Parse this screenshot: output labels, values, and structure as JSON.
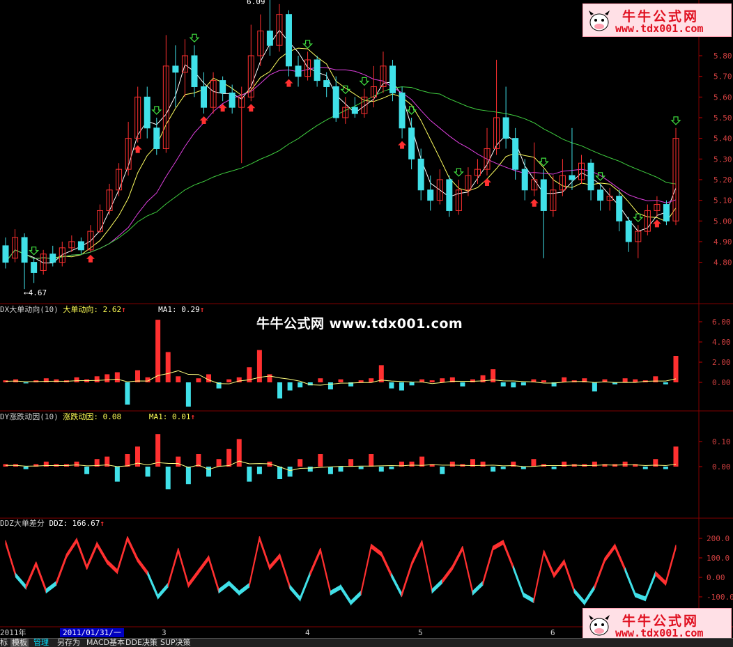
{
  "watermark_center": "牛牛公式网 www.tdx001.com",
  "logo": {
    "line1": "牛牛公式网",
    "line2": "www.tdx001.com",
    "icon": "cow-icon"
  },
  "main_panel": {
    "high_label": "6.09",
    "low_label": "←4.67",
    "price_ticks": [
      "5.80",
      "5.70",
      "5.60",
      "5.50",
      "5.40",
      "5.30",
      "5.20",
      "5.10",
      "5.00",
      "4.90",
      "4.80"
    ]
  },
  "panel1": {
    "name": "DX大单动向(10)",
    "value_label": "大单动向: 2.62",
    "ma_label": "MA1: 0.29",
    "ticks": [
      "6.00",
      "4.00",
      "2.00",
      "0.00"
    ]
  },
  "panel2": {
    "name": "DY涨跌动因(10)",
    "value_label": "涨跌动因: 0.08",
    "ma_label": "MA1: 0.01",
    "ticks": [
      "0.10",
      "0.00"
    ]
  },
  "panel3": {
    "name": "DDZ大单差分",
    "value_label": "DDZ: 166.67",
    "ticks": [
      "200.0",
      "100.0",
      "0.00",
      "-100.0"
    ]
  },
  "time_axis": {
    "year_label": "2011年",
    "cursor_date": "2011/01/31/一",
    "month_labels": [
      "3",
      "4",
      "5",
      "6"
    ]
  },
  "bottom_tabs": [
    "标",
    "模板",
    "管理",
    "另存为",
    "MACD基本",
    "DDE决策",
    "SUP决策"
  ],
  "colors": {
    "up": "#ff3030",
    "down": "#40e0e8",
    "ma5": "#ffffff",
    "ma10": "#ffff60",
    "ma20": "#e040e0",
    "ma60": "#40d040",
    "grid": "#800000"
  },
  "chart_data": {
    "type": "candlestick",
    "y_range": [
      4.67,
      6.09
    ],
    "candles": [
      {
        "o": 4.88,
        "c": 4.8,
        "h": 4.92,
        "l": 4.77
      },
      {
        "o": 4.82,
        "c": 4.92,
        "h": 4.96,
        "l": 4.8
      },
      {
        "o": 4.92,
        "c": 4.8,
        "h": 4.94,
        "l": 4.67
      },
      {
        "o": 4.8,
        "c": 4.75,
        "h": 4.82,
        "l": 4.7
      },
      {
        "o": 4.76,
        "c": 4.84,
        "h": 4.86,
        "l": 4.74
      },
      {
        "o": 4.84,
        "c": 4.8,
        "h": 4.88,
        "l": 4.78
      },
      {
        "o": 4.8,
        "c": 4.87,
        "h": 4.9,
        "l": 4.78
      },
      {
        "o": 4.87,
        "c": 4.9,
        "h": 4.93,
        "l": 4.85
      },
      {
        "o": 4.9,
        "c": 4.86,
        "h": 4.92,
        "l": 4.84
      },
      {
        "o": 4.86,
        "c": 4.95,
        "h": 4.98,
        "l": 4.85
      },
      {
        "o": 4.95,
        "c": 5.05,
        "h": 5.08,
        "l": 4.94
      },
      {
        "o": 5.05,
        "c": 5.15,
        "h": 5.18,
        "l": 5.03
      },
      {
        "o": 5.15,
        "c": 5.25,
        "h": 5.28,
        "l": 5.12
      },
      {
        "o": 5.25,
        "c": 5.4,
        "h": 5.48,
        "l": 5.22
      },
      {
        "o": 5.4,
        "c": 5.6,
        "h": 5.65,
        "l": 5.38
      },
      {
        "o": 5.6,
        "c": 5.45,
        "h": 5.65,
        "l": 5.4
      },
      {
        "o": 5.45,
        "c": 5.35,
        "h": 5.5,
        "l": 5.32
      },
      {
        "o": 5.35,
        "c": 5.75,
        "h": 5.9,
        "l": 5.33
      },
      {
        "o": 5.75,
        "c": 5.72,
        "h": 5.85,
        "l": 5.55
      },
      {
        "o": 5.72,
        "c": 5.8,
        "h": 5.88,
        "l": 5.6
      },
      {
        "o": 5.8,
        "c": 5.65,
        "h": 5.85,
        "l": 5.6
      },
      {
        "o": 5.65,
        "c": 5.55,
        "h": 5.72,
        "l": 5.52
      },
      {
        "o": 5.55,
        "c": 5.68,
        "h": 5.72,
        "l": 5.52
      },
      {
        "o": 5.68,
        "c": 5.62,
        "h": 5.7,
        "l": 5.58
      },
      {
        "o": 5.62,
        "c": 5.55,
        "h": 5.66,
        "l": 5.52
      },
      {
        "o": 5.55,
        "c": 5.6,
        "h": 5.65,
        "l": 5.28
      },
      {
        "o": 5.6,
        "c": 5.8,
        "h": 5.95,
        "l": 5.58
      },
      {
        "o": 5.8,
        "c": 5.92,
        "h": 6.0,
        "l": 5.75
      },
      {
        "o": 5.92,
        "c": 5.85,
        "h": 6.09,
        "l": 5.8
      },
      {
        "o": 5.85,
        "c": 6.0,
        "h": 6.05,
        "l": 5.82
      },
      {
        "o": 6.0,
        "c": 5.75,
        "h": 6.02,
        "l": 5.7
      },
      {
        "o": 5.75,
        "c": 5.7,
        "h": 5.8,
        "l": 5.65
      },
      {
        "o": 5.7,
        "c": 5.78,
        "h": 5.82,
        "l": 5.68
      },
      {
        "o": 5.78,
        "c": 5.68,
        "h": 5.8,
        "l": 5.65
      },
      {
        "o": 5.68,
        "c": 5.65,
        "h": 5.72,
        "l": 5.6
      },
      {
        "o": 5.65,
        "c": 5.5,
        "h": 5.7,
        "l": 5.48
      },
      {
        "o": 5.5,
        "c": 5.55,
        "h": 5.6,
        "l": 5.47
      },
      {
        "o": 5.55,
        "c": 5.52,
        "h": 5.6,
        "l": 5.5
      },
      {
        "o": 5.52,
        "c": 5.6,
        "h": 5.64,
        "l": 5.5
      },
      {
        "o": 5.6,
        "c": 5.65,
        "h": 5.75,
        "l": 5.55
      },
      {
        "o": 5.65,
        "c": 5.75,
        "h": 5.82,
        "l": 5.62
      },
      {
        "o": 5.75,
        "c": 5.62,
        "h": 5.78,
        "l": 5.58
      },
      {
        "o": 5.62,
        "c": 5.45,
        "h": 5.65,
        "l": 5.4
      },
      {
        "o": 5.45,
        "c": 5.3,
        "h": 5.5,
        "l": 5.25
      },
      {
        "o": 5.3,
        "c": 5.15,
        "h": 5.35,
        "l": 5.1
      },
      {
        "o": 5.15,
        "c": 5.1,
        "h": 5.22,
        "l": 5.05
      },
      {
        "o": 5.1,
        "c": 5.2,
        "h": 5.25,
        "l": 5.08
      },
      {
        "o": 5.2,
        "c": 5.05,
        "h": 5.22,
        "l": 5.02
      },
      {
        "o": 5.05,
        "c": 5.15,
        "h": 5.2,
        "l": 5.03
      },
      {
        "o": 5.15,
        "c": 5.22,
        "h": 5.26,
        "l": 5.12
      },
      {
        "o": 5.22,
        "c": 5.25,
        "h": 5.3,
        "l": 5.18
      },
      {
        "o": 5.25,
        "c": 5.35,
        "h": 5.45,
        "l": 5.22
      },
      {
        "o": 5.35,
        "c": 5.5,
        "h": 5.78,
        "l": 5.32
      },
      {
        "o": 5.5,
        "c": 5.4,
        "h": 5.65,
        "l": 5.35
      },
      {
        "o": 5.4,
        "c": 5.25,
        "h": 5.45,
        "l": 5.2
      },
      {
        "o": 5.25,
        "c": 5.15,
        "h": 5.3,
        "l": 5.1
      },
      {
        "o": 5.15,
        "c": 5.2,
        "h": 5.38,
        "l": 5.12
      },
      {
        "o": 5.2,
        "c": 5.05,
        "h": 5.25,
        "l": 4.82
      },
      {
        "o": 5.05,
        "c": 5.15,
        "h": 5.22,
        "l": 5.02
      },
      {
        "o": 5.15,
        "c": 5.22,
        "h": 5.3,
        "l": 5.12
      },
      {
        "o": 5.22,
        "c": 5.2,
        "h": 5.45,
        "l": 5.15
      },
      {
        "o": 5.2,
        "c": 5.28,
        "h": 5.32,
        "l": 5.18
      },
      {
        "o": 5.28,
        "c": 5.15,
        "h": 5.3,
        "l": 5.1
      },
      {
        "o": 5.15,
        "c": 5.1,
        "h": 5.18,
        "l": 5.05
      },
      {
        "o": 5.1,
        "c": 5.12,
        "h": 5.16,
        "l": 5.05
      },
      {
        "o": 5.12,
        "c": 5.0,
        "h": 5.15,
        "l": 4.95
      },
      {
        "o": 5.0,
        "c": 4.9,
        "h": 5.02,
        "l": 4.85
      },
      {
        "o": 4.9,
        "c": 4.95,
        "h": 4.98,
        "l": 4.82
      },
      {
        "o": 4.95,
        "c": 5.05,
        "h": 5.08,
        "l": 4.93
      },
      {
        "o": 5.05,
        "c": 5.08,
        "h": 5.12,
        "l": 5.02
      },
      {
        "o": 5.08,
        "c": 5.0,
        "h": 5.1,
        "l": 4.98
      },
      {
        "o": 5.0,
        "c": 5.4,
        "h": 5.45,
        "l": 4.98
      }
    ],
    "panel1_values": [
      0.2,
      0.3,
      -0.1,
      0.2,
      0.4,
      0.3,
      0.2,
      0.5,
      0.3,
      0.6,
      0.8,
      1.0,
      -2.2,
      1.2,
      0.5,
      6.2,
      3.0,
      0.6,
      -2.4,
      0.4,
      0.8,
      -0.6,
      0.3,
      0.5,
      1.5,
      3.2,
      0.8,
      -1.6,
      -0.8,
      -0.5,
      -0.3,
      0.4,
      -0.7,
      0.3,
      -0.4,
      0.2,
      0.4,
      1.7,
      -0.6,
      -0.8,
      -0.3,
      0.3,
      0.2,
      0.4,
      0.5,
      -0.4,
      0.3,
      0.7,
      1.3,
      -0.4,
      -0.5,
      -0.3,
      0.3,
      0.2,
      -0.4,
      0.5,
      0.2,
      0.4,
      -0.9,
      0.3,
      -0.2,
      0.4,
      0.3,
      0.2,
      0.6,
      -0.2,
      2.62
    ],
    "panel2_values": [
      0.01,
      0.01,
      -0.01,
      0.01,
      0.02,
      0.01,
      0.01,
      0.02,
      -0.03,
      0.03,
      0.04,
      -0.06,
      0.05,
      0.08,
      -0.04,
      0.13,
      -0.09,
      0.04,
      -0.07,
      0.05,
      -0.04,
      0.03,
      0.07,
      0.11,
      -0.06,
      -0.03,
      0.02,
      -0.05,
      -0.04,
      0.03,
      -0.02,
      0.05,
      -0.03,
      -0.02,
      0.03,
      -0.01,
      0.05,
      -0.02,
      -0.01,
      0.02,
      0.02,
      0.04,
      0.01,
      -0.03,
      0.02,
      0.01,
      0.03,
      0.02,
      -0.02,
      -0.01,
      0.02,
      -0.01,
      0.03,
      0.01,
      -0.01,
      0.02,
      0.01,
      0.01,
      0.02,
      0.01,
      0.01,
      0.02,
      0.01,
      -0.01,
      0.03,
      -0.01,
      0.08
    ],
    "panel3_values": [
      190,
      20,
      -40,
      80,
      -60,
      -20,
      120,
      200,
      60,
      180,
      90,
      40,
      210,
      100,
      30,
      -90,
      -30,
      150,
      -30,
      40,
      110,
      -60,
      -20,
      -70,
      -30,
      210,
      60,
      120,
      -40,
      -100,
      30,
      150,
      -70,
      -40,
      -120,
      -70,
      170,
      130,
      20,
      -80,
      80,
      190,
      -60,
      -10,
      60,
      160,
      -70,
      -20,
      160,
      190,
      60,
      -80,
      -110,
      140,
      20,
      90,
      -60,
      -120,
      -40,
      100,
      170,
      50,
      -80,
      -100,
      30,
      -20,
      166.67
    ],
    "arrows_down_idx": [
      3,
      16,
      20,
      28,
      32,
      36,
      38,
      43,
      48,
      57,
      63,
      67,
      71,
      75,
      80,
      84,
      88,
      91,
      96
    ],
    "arrows_up_idx": [
      9,
      14,
      21,
      23,
      26,
      30,
      42,
      51,
      56,
      69,
      73,
      82,
      90,
      99
    ]
  }
}
